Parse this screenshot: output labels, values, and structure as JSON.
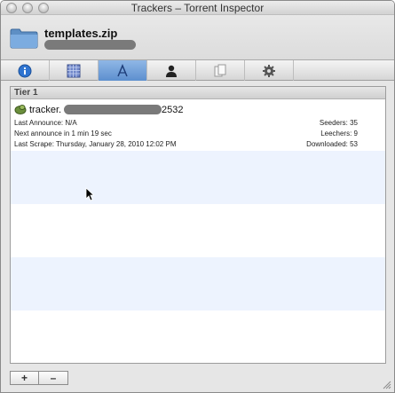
{
  "window": {
    "title": "Trackers – Torrent Inspector"
  },
  "header": {
    "file_name": "templates.zip"
  },
  "tabs": [
    {
      "icon": "info-icon"
    },
    {
      "icon": "pieces-grid-icon"
    },
    {
      "icon": "trackers-icon",
      "active": true
    },
    {
      "icon": "peers-person-icon"
    },
    {
      "icon": "files-icon"
    },
    {
      "icon": "options-gear-icon"
    }
  ],
  "tier": {
    "label": "Tier 1"
  },
  "tracker": {
    "host_prefix": "tracker.",
    "port_suffix": "2532",
    "last_announce": "Last Announce: N/A",
    "next_announce": "Next announce in 1 min 19 sec",
    "last_scrape": "Last Scrape: Thursday, January 28, 2010 12:02 PM",
    "seeders": "Seeders: 35",
    "leechers": "Leechers: 9",
    "downloaded": "Downloaded: 53"
  },
  "buttons": {
    "add_label": "+",
    "remove_label": "–"
  }
}
